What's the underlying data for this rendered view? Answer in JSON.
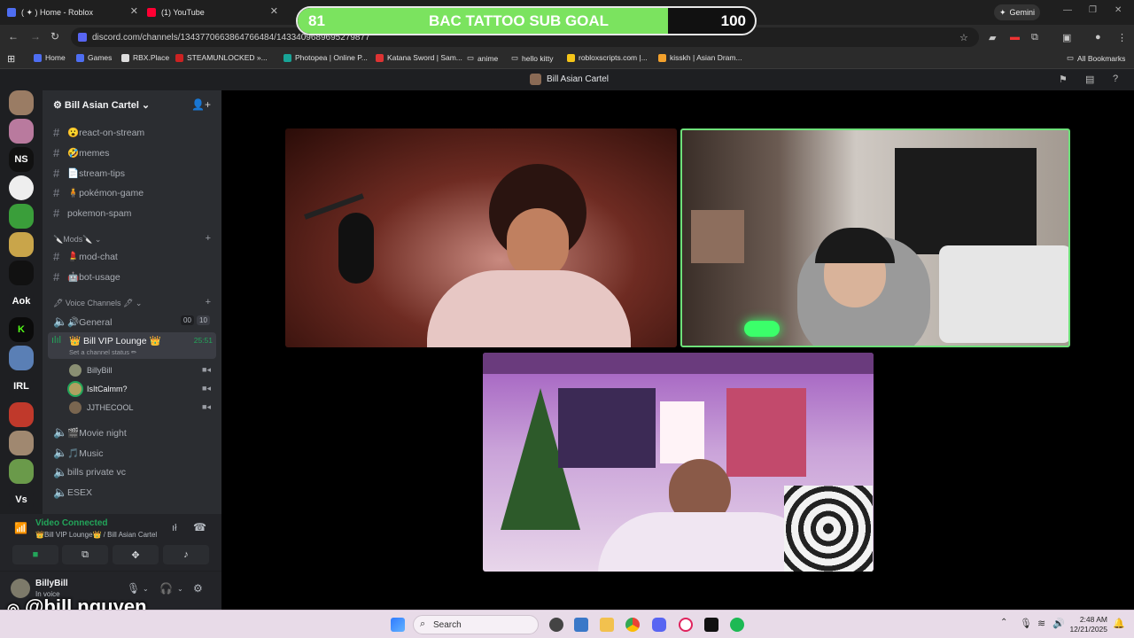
{
  "browser": {
    "tabs": [
      {
        "label": "( ✦ ) Home - Roblox"
      },
      {
        "label": "(1) YouTube"
      }
    ],
    "gemini_label": "Gemini",
    "url": "discord.com/channels/1343770663864766484/1433409689695279877",
    "bookmarks": [
      "Home",
      "Games",
      "RBX.Place",
      "STEAMUNLOCKED »...",
      "Photopea | Online P...",
      "Katana Sword | Sam...",
      "anime",
      "hello kitty",
      "robloxscripts.com |...",
      "kisskh | Asian Dram...",
      "All Bookmarks"
    ]
  },
  "overlay": {
    "goal_start": "81",
    "goal_title": "BAC TATTOO SUB GOAL",
    "goal_end": "100",
    "goal_progress": 0.81,
    "handle": "@bill.nguyen"
  },
  "discord": {
    "title": "Bill Asian Cartel",
    "server_name": "Bill Asian Cartel",
    "servers": [
      "",
      "",
      "NS",
      "",
      "",
      "",
      "",
      "Aok",
      "",
      "",
      "IRL",
      "",
      "",
      "",
      "Vs"
    ],
    "text_channels": [
      {
        "label": "😮react-on-stream"
      },
      {
        "label": "🤣memes"
      },
      {
        "label": "📄stream-tips"
      },
      {
        "label": "🧍pokémon-game"
      },
      {
        "label": "pokemon-spam"
      }
    ],
    "mods_category": "🔪Mods🔪",
    "mod_channels": [
      {
        "label": "💄mod-chat"
      },
      {
        "label": "🤖bot-usage"
      }
    ],
    "voice_category": "🖋 Voice Channels 🖋",
    "general": {
      "label": "🔊General",
      "count_a": "00",
      "count_b": "10"
    },
    "active_vc": {
      "label": "👑 Bill VIP Lounge 👑",
      "time": "25:51",
      "status": "Set a channel status ✏"
    },
    "members": [
      {
        "name": "BillyBill",
        "color": "#b5bac1"
      },
      {
        "name": "IsItCalmm?",
        "color": "#f2f3f5"
      },
      {
        "name": "JJTHECOOL",
        "color": "#b5bac1"
      }
    ],
    "other_voice": [
      {
        "label": "🎬Movie night"
      },
      {
        "label": "🎵Music"
      },
      {
        "label": "bills private vc"
      },
      {
        "label": "ESEX"
      }
    ],
    "voice_panel": {
      "connected": "Video Connected",
      "location": "👑Bill VIP Lounge👑 / Bill Asian Cartel"
    },
    "user": {
      "name": "BillyBill",
      "status": "In voice"
    }
  },
  "taskbar": {
    "search": "Search",
    "time": "2:48 AM",
    "date": "12/21/2025"
  },
  "colors": {
    "accent": "#5865f2",
    "voice_green": "#23a55a",
    "goal_green": "#7be35f",
    "speaking_border": "#6ee07a"
  }
}
